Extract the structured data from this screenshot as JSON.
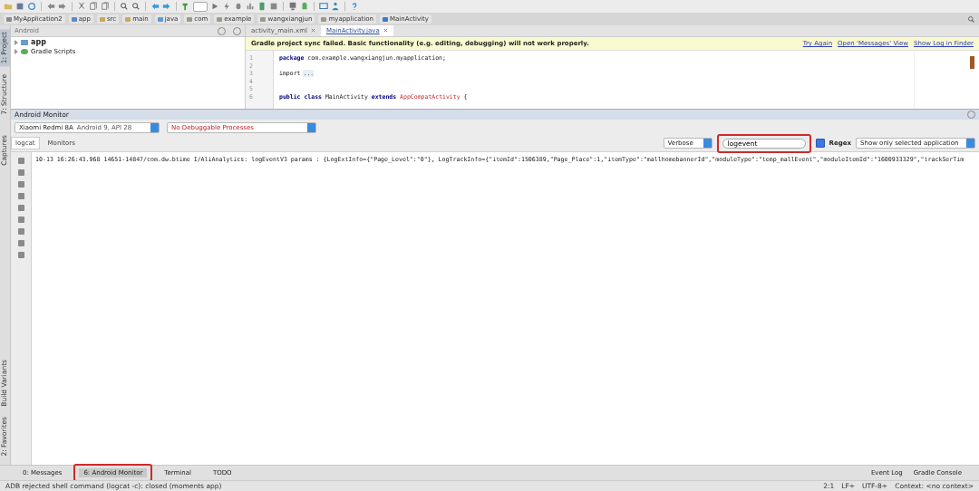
{
  "breadcrumbs": [
    {
      "label": "MyApplication2",
      "kind": "project"
    },
    {
      "label": "app",
      "kind": "module"
    },
    {
      "label": "src",
      "kind": "folder"
    },
    {
      "label": "main",
      "kind": "folder"
    },
    {
      "label": "java",
      "kind": "source"
    },
    {
      "label": "com",
      "kind": "package"
    },
    {
      "label": "example",
      "kind": "package"
    },
    {
      "label": "wangxiangjun",
      "kind": "package"
    },
    {
      "label": "myapplication",
      "kind": "package"
    },
    {
      "label": "MainActivity",
      "kind": "class"
    }
  ],
  "left_strip": {
    "top": [
      {
        "label": "1: Project",
        "selected": true
      },
      {
        "label": "7: Structure",
        "selected": false
      }
    ],
    "middle": [
      {
        "label": "Captures",
        "selected": false
      }
    ],
    "bottom": [
      {
        "label": "Build Variants",
        "selected": false
      },
      {
        "label": "2: Favorites",
        "selected": false
      }
    ]
  },
  "project_panel": {
    "view": "Android",
    "tree": [
      {
        "label": "app",
        "kind": "module",
        "expanded": false
      },
      {
        "label": "Gradle Scripts",
        "kind": "gradle",
        "expanded": false
      }
    ]
  },
  "editor_tabs": [
    {
      "label": "activity_main.xml",
      "selected": false
    },
    {
      "label": "MainActivity.java",
      "selected": true
    }
  ],
  "notification": {
    "message": "Gradle project sync failed. Basic functionality (e.g. editing, debugging) will not work properly.",
    "links": [
      "Try Again",
      "Open 'Messages' View",
      "Show Log in Finder"
    ]
  },
  "code_lines": [
    {
      "number": "1",
      "tokens": [
        {
          "text": "package",
          "kind": "keyword"
        },
        {
          "text": " com.example.wangxiangjun.myapplication;",
          "kind": "plain"
        }
      ]
    },
    {
      "number": "2"
    },
    {
      "number": "3",
      "tokens": [
        {
          "text": "import",
          "kind": "plain"
        },
        {
          "text": "...",
          "kind": "folded"
        }
      ]
    },
    {
      "number": "4"
    },
    {
      "number": "5"
    },
    {
      "number": "6",
      "tokens": [
        {
          "text": "public class",
          "kind": "keyword"
        },
        {
          "text": " MainActivity ",
          "kind": "plain"
        },
        {
          "text": "extends",
          "kind": "keyword"
        },
        {
          "text": " AppCompatActivity",
          "kind": "type"
        },
        {
          "text": " {",
          "kind": "plain"
        }
      ]
    }
  ],
  "monitor": {
    "title": "Android Monitor",
    "device": "Xiaomi Redmi 8A",
    "device_detail": "Android 9, API 28",
    "process": "No Debuggable Processes",
    "tabs": [
      {
        "label": "logcat",
        "selected": true
      },
      {
        "label": "Monitors",
        "selected": false
      }
    ],
    "log_level": "Verbose",
    "search": {
      "value": "logevent",
      "highlighted": true
    },
    "regex": {
      "label": "Regex",
      "checked": true
    },
    "filter": "Show only selected application",
    "lines": [
      "10-13 16:26:43.968 14651-14847/com.dw.btime I/AliAnalytics: logEventV3 params : {LogExtInfo={\"Page_Level\":\"0\"}, LogTrackInfo={\"itemId\":1506389,\"Page_Place\":1,\"itemType\":\"mallhomebannerId\",\"moduleType\":\"temp_mallEvent\",\"moduleItemId\":\"1600933329\",\"trackSerTim"
    ]
  },
  "bottom_tabs": [
    {
      "label": "0: Messages",
      "selected": false,
      "highlighted": false
    },
    {
      "label": "6: Android Monitor",
      "selected": true,
      "highlighted": true
    },
    {
      "label": "Terminal",
      "selected": false,
      "highlighted": false
    },
    {
      "label": "TODO",
      "selected": false,
      "highlighted": false
    }
  ],
  "bottom_right_tabs": [
    "Event Log",
    "Gradle Console"
  ],
  "status": {
    "message": "ADB rejected shell command (logcat -c): closed (moments app)",
    "position": "2:1",
    "line_separator": "LF÷",
    "encoding": "UTF-8÷",
    "context": "Context: <no context>"
  }
}
